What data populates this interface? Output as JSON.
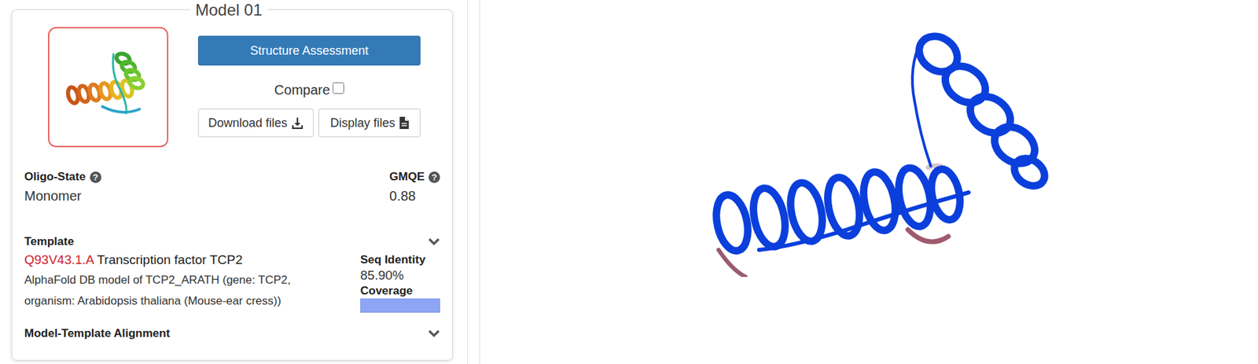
{
  "model": {
    "title": "Model 01"
  },
  "buttons": {
    "structure_assessment": "Structure Assessment",
    "download": "Download files",
    "display": "Display files"
  },
  "compare": {
    "label": "Compare",
    "checked": false
  },
  "oligo_state": {
    "label": "Oligo-State",
    "help": "?",
    "value": "Monomer"
  },
  "gmqe": {
    "label": "GMQE",
    "help": "?",
    "value": "0.88"
  },
  "template": {
    "label": "Template",
    "expanded": false,
    "id": "Q93V43.1.A",
    "name": "Transcription factor TCP2",
    "description": "AlphaFold DB model of TCP2_ARATH (gene: TCP2, organism: Arabidopsis thaliana (Mouse-ear cress))",
    "seq_identity_label": "Seq Identity",
    "seq_identity": "85.90%",
    "coverage_label": "Coverage",
    "coverage_level": 1.0
  },
  "alignment": {
    "label": "Model-Template Alignment",
    "expanded": false
  }
}
